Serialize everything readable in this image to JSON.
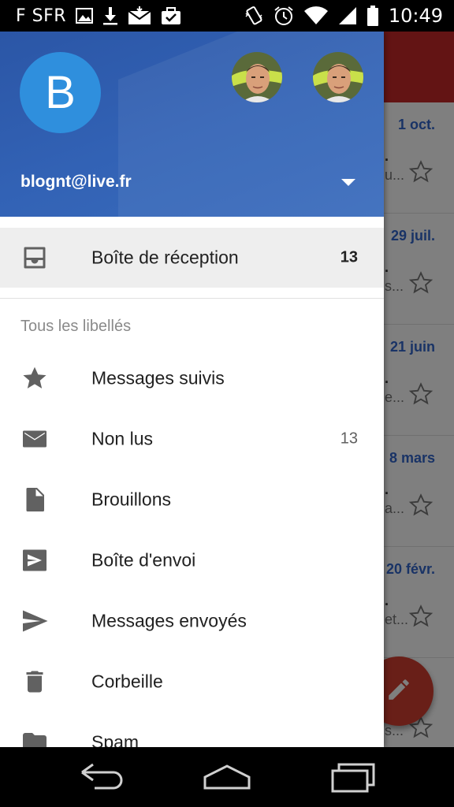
{
  "status_bar": {
    "carrier": "F SFR",
    "time": "10:49",
    "left_icons": [
      "image-icon",
      "download-icon",
      "mail-icon",
      "briefcase-check-icon"
    ],
    "right_icons": [
      "vibrate-icon",
      "alarm-icon",
      "wifi-icon",
      "signal-icon",
      "battery-icon"
    ]
  },
  "colors": {
    "header_blue": "#3262b5",
    "avatar_blue": "#2f8fdd",
    "toolbar_red": "#c62828",
    "fab_red": "#d23f31",
    "date_blue": "#3366cc",
    "selected_bg": "#eeeeee"
  },
  "drawer": {
    "header": {
      "avatar_letter": "B",
      "email": "blognt@live.fr"
    },
    "inbox": {
      "label": "Boîte de réception",
      "count": "13",
      "icon": "inbox-icon"
    },
    "section_title": "Tous les libellés",
    "items": [
      {
        "label": "Messages suivis",
        "icon": "star-icon",
        "count": ""
      },
      {
        "label": "Non lus",
        "icon": "mail-icon",
        "count": "13"
      },
      {
        "label": "Brouillons",
        "icon": "draft-icon",
        "count": ""
      },
      {
        "label": "Boîte d'envoi",
        "icon": "outbox-icon",
        "count": ""
      },
      {
        "label": "Messages envoyés",
        "icon": "send-icon",
        "count": ""
      },
      {
        "label": "Corbeille",
        "icon": "trash-icon",
        "count": ""
      },
      {
        "label": "Spam",
        "icon": "folder-icon",
        "count": ""
      }
    ]
  },
  "background_list": {
    "dates": [
      "1 oct.",
      "29 juil.",
      "21 juin",
      "8 mars",
      "20 févr."
    ],
    "snippets": [
      "u...",
      "s...",
      "e...",
      "a...",
      "et...",
      "s..."
    ]
  },
  "nav_bar": [
    "back-icon",
    "home-icon",
    "recents-icon"
  ]
}
